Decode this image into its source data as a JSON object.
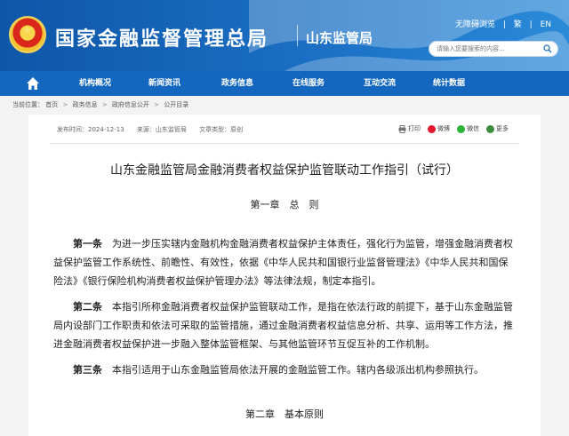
{
  "header": {
    "site_title": "国家金融监督管理总局",
    "bureau": "山东监管局",
    "top_links": [
      "无障碍浏览",
      "繁",
      "EN"
    ],
    "search_placeholder": "请输入您要搜索的内容..."
  },
  "nav": {
    "items": [
      "机构概况",
      "新闻资讯",
      "政务信息",
      "在线服务",
      "互动交流",
      "统计数据"
    ]
  },
  "breadcrumb": {
    "label": "当前位置：",
    "items": [
      "首页",
      "政务信息",
      "政府信息公开",
      "公开目录"
    ]
  },
  "article": {
    "date": "发布时间：2024-12-13",
    "source": "来源：山东监管局",
    "type": "文章类型：原创",
    "share": [
      "打印",
      "微博",
      "微信",
      "更多"
    ],
    "title": "山东金融监管局金融消费者权益保护监管联动工作指引（试行）",
    "chapter1": "第一章　总　则",
    "art1_label": "第一条",
    "art1_text": "为进一步压实辖内金融机构金融消费者权益保护主体责任，强化行为监管，增强金融消费者权益保护监管工作系统性、前瞻性、有效性，依据《中华人民共和国银行业监督管理法》《中华人民共和国保险法》《银行保险机构消费者权益保护管理办法》等法律法规，制定本指引。",
    "art2_label": "第二条",
    "art2_text": "本指引所称金融消费者权益保护监管联动工作，是指在依法行政的前提下，基于山东金融监管局内设部门工作职责和依法可采取的监管措施，通过金融消费者权益信息分析、共享、运用等工作方法，推进金融消费者权益保护进一步融入整体监管框架、与其他监管环节互促互补的工作机制。",
    "art3_label": "第三条",
    "art3_text": "本指引适用于山东金融监管局依法开展的金融监管工作。辖内各级派出机构参照执行。",
    "chapter2": "第二章　基本原则"
  }
}
